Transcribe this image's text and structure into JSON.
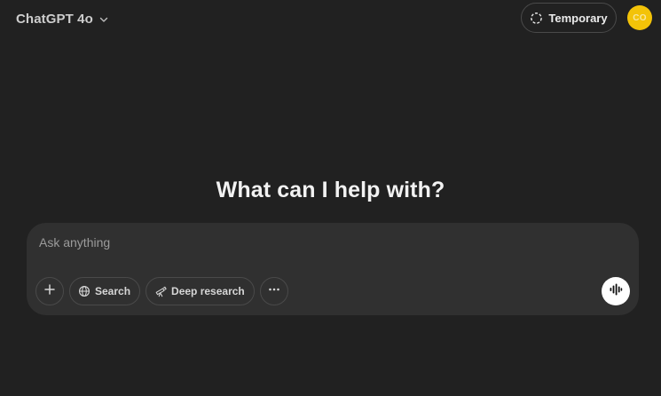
{
  "header": {
    "model_label": "ChatGPT 4o",
    "temporary_label": "Temporary",
    "avatar_initials": "CO"
  },
  "main": {
    "headline": "What can I help with?"
  },
  "composer": {
    "placeholder": "Ask anything",
    "value": "",
    "tools": {
      "add_icon": "plus-icon",
      "search_label": "Search",
      "deep_research_label": "Deep research",
      "more_icon": "ellipsis-icon"
    },
    "voice_icon": "voice-waveform-icon"
  },
  "colors": {
    "background": "#212121",
    "composer_bg": "#303030",
    "avatar_bg": "#f3c308",
    "button_border": "#4a4a4a",
    "voice_button_bg": "#ffffff"
  }
}
